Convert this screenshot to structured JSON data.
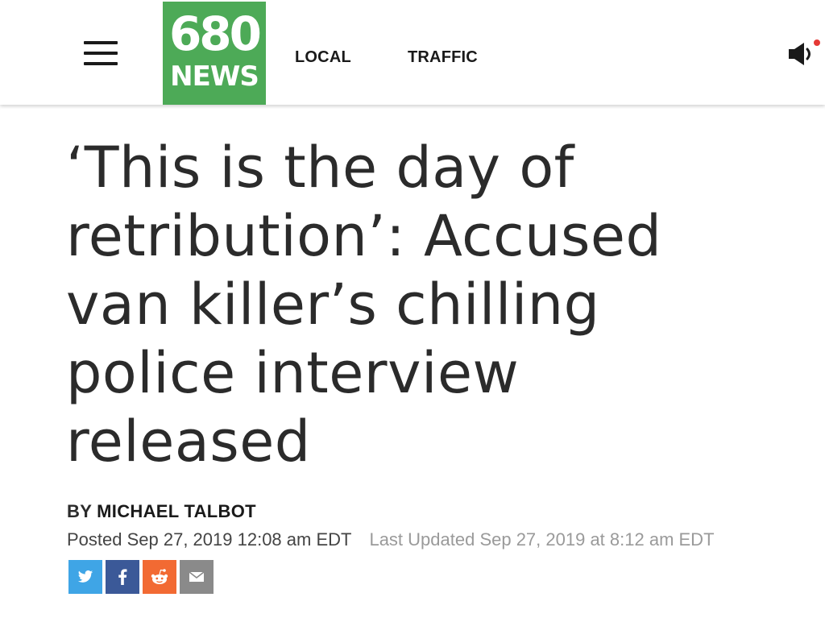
{
  "header": {
    "logo": {
      "number": "680",
      "word": "NEWS",
      "bg_color": "#4daa57"
    },
    "nav": [
      {
        "label": "LOCAL"
      },
      {
        "label": "TRAFFIC"
      }
    ],
    "menu_icon": "hamburger-menu-icon",
    "audio_icon": "speaker-icon",
    "audio_indicator_color": "#e53935"
  },
  "article": {
    "headline": "‘This is the day of retribution’: Accused van killer’s chilling police interview released",
    "byline_prefix": "BY",
    "author": "MICHAEL TALBOT",
    "posted": "Posted Sep 27, 2019 12:08 am EDT",
    "updated": "Last Updated Sep 27, 2019 at 8:12 am EDT"
  },
  "share": [
    {
      "name": "twitter",
      "icon": "twitter-icon",
      "color": "#3fa5e6"
    },
    {
      "name": "facebook",
      "icon": "facebook-icon",
      "color": "#3b5998"
    },
    {
      "name": "reddit",
      "icon": "reddit-icon",
      "color": "#f26a33"
    },
    {
      "name": "email",
      "icon": "email-icon",
      "color": "#8a8a8a"
    }
  ]
}
